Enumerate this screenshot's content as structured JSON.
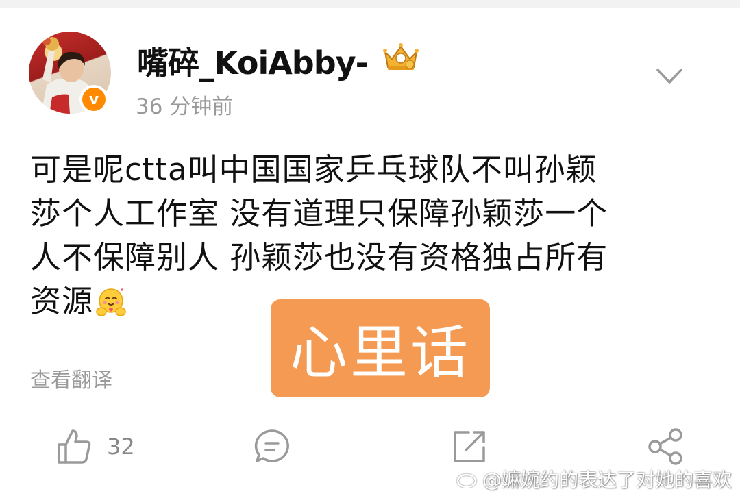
{
  "author": {
    "name": "嘴碎_KoiAbby-",
    "verified_badge": "v",
    "timestamp": "36 分钟前",
    "avatar_icon": "user-avatar",
    "rank_icon": "crown-icon"
  },
  "post": {
    "lines": [
      "可是呢ctta叫中国国家乒乓球队不叫孙颖",
      "莎个人工作室 没有道理只保障孙颖莎一个",
      "人不保障别人 孙颖莎也没有资格独占所有",
      "资源"
    ],
    "emoji_icon": "hugging-face-emoji",
    "translate_label": "查看翻译"
  },
  "sticker": {
    "text": "心里话",
    "color": "#f59a52"
  },
  "actions": {
    "like_count": "32",
    "like_icon": "thumbs-up-icon",
    "comment_icon": "comment-icon",
    "repost_icon": "repost-icon",
    "share_icon": "share-icon"
  },
  "watermark": {
    "text": "@嫲婉约的表达了对她的喜欢",
    "icon": "weibo-logo"
  },
  "colors": {
    "accent": "#ff8a00",
    "muted": "#9a9a9a",
    "sticker": "#f59a52"
  }
}
